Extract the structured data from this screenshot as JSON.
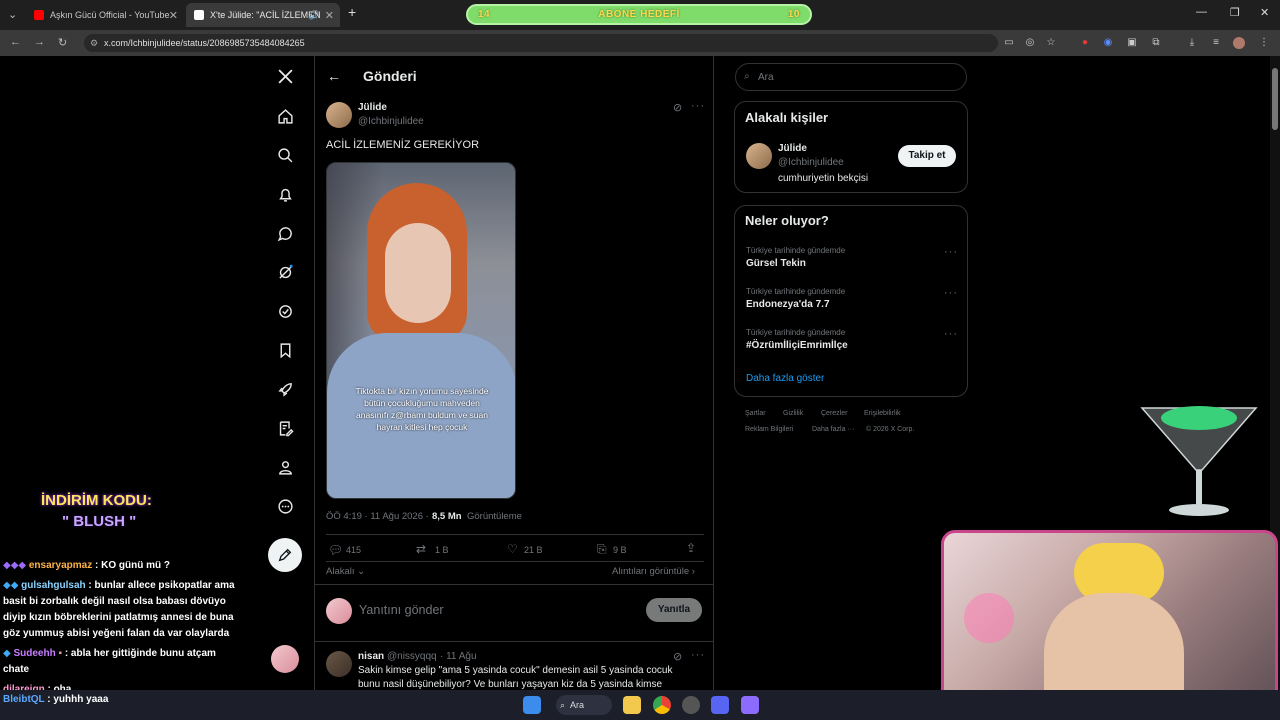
{
  "browser": {
    "tabs": [
      {
        "title": "Aşkın Gücü Official - YouTube",
        "favicon_color": "#ff0000"
      },
      {
        "title": "X'te Jülide: \"ACİL İZLEMEN",
        "favicon_color": "#ffffff"
      }
    ],
    "new_tab": "+",
    "url": "x.com/Ichbinjulidee/status/2086985735484084265"
  },
  "stream_overlay": {
    "goal_left": "14",
    "goal_label": "ABONE HEDEFİ",
    "goal_right": "10",
    "promo_title": "İNDİRİM KODU:",
    "promo_code": "\" BLUSH \"",
    "goal_accent": "#7fdc6a"
  },
  "sidebar": {
    "icons": [
      "x-logo-icon",
      "home-icon",
      "search-icon",
      "bell-icon",
      "message-icon",
      "grok-icon",
      "verified-icon",
      "bookmark-icon",
      "rocket-icon",
      "notes-icon",
      "profile-icon",
      "more-icon",
      "compose-icon"
    ]
  },
  "header": {
    "title": "Gönderi"
  },
  "post": {
    "author_name": "Jülide",
    "author_handle": "@Ichbinjulidee",
    "text": "ACİL İZLEMENİZ GEREKİYOR",
    "video_caption": "Tiktokta bir kızın yorumu sayesinde bütün çocukluğumu mahveden anasınıfı z@rbamı buldum ve suan hayran kitlesi hep çocuk",
    "timestamp": "ÖÖ 4:19 · 11 Ağu 2026 ·",
    "views_count": "8,5 Mn",
    "views_label": "Görüntüleme",
    "replies": "415",
    "reposts": "1 B",
    "likes": "21 B",
    "bookmarks": "9 B",
    "relevant_label": "Alakalı",
    "quotes_label": "Alıntıları görüntüle",
    "reply_placeholder": "Yanıtını gönder",
    "reply_button": "Yanıtla"
  },
  "reply": {
    "name": "nisan",
    "handle": "@nissyqqq",
    "date": "· 11 Ağu",
    "text_line1": "Sakin kimse gelip \"ama 5 yasinda cocuk\" demesin asil 5 yasinda cocuk",
    "text_line2": "bunu nasil düşünebiliyor? Ve bunları yaşayan kiz da 5 yasinda kimse"
  },
  "right": {
    "search_placeholder": "Ara",
    "people_title": "Alakalı kişiler",
    "person": {
      "name": "Jülide",
      "handle": "@Ichbinjulidee",
      "bio": "cumhuriyetin bekçisi",
      "follow": "Takip et"
    },
    "trends_title": "Neler oluyor?",
    "trends": [
      {
        "context": "Türkiye tarihinde gündemde",
        "title": "Gürsel Tekin"
      },
      {
        "context": "Türkiye tarihinde gündemde",
        "title": "Endonezya'da 7.7"
      },
      {
        "context": "Türkiye tarihinde gündemde",
        "title": "#ÖzrümİliçiEmrimİlçe"
      }
    ],
    "show_more": "Daha fazla göster",
    "footer_line1": [
      "Şartlar",
      "Gizlilik",
      "Çerezler",
      "Erişilebilirlik"
    ],
    "footer_line2": [
      "Reklam Bilgileri",
      "Daha fazla ···",
      "© 2026 X Corp."
    ]
  },
  "chat": [
    {
      "user": "ensaryapmaz",
      "message": ": KO günü mü ?",
      "color": "#ffb347"
    },
    {
      "user": "gulsahgulsah",
      "message": ": bunlar allece psikopatlar ama",
      "color": "#8bd3ff"
    },
    {
      "user": "",
      "message": "basit bi zorbalık değil nasıl olsa babası dövüyo",
      "color": "#ffffff"
    },
    {
      "user": "",
      "message": "diyip kızın böbreklerini patlatmış annesi de buna",
      "color": "#ffffff"
    },
    {
      "user": "",
      "message": "göz yummuş abisi yeğeni falan da var olaylarda",
      "color": "#ffffff"
    },
    {
      "user": "Sudeehh",
      "message": ": abla her gittiğinde bunu atçam",
      "color": "#c77dff"
    },
    {
      "user": "",
      "message": "chate",
      "color": "#ffffff"
    },
    {
      "user": "dilareign",
      "message": ": oha",
      "color": "#ff9bd2"
    },
    {
      "user": "BleibtQL",
      "message": ": yuhhh yaaa",
      "color": "#5aa8ff"
    }
  ],
  "taskbar": {
    "search_label": "Ara"
  }
}
